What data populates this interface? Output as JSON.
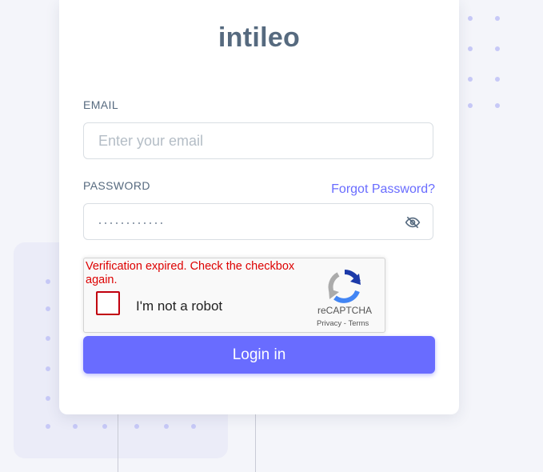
{
  "brand": {
    "logo_text": "intileo"
  },
  "form": {
    "email": {
      "label": "EMAIL",
      "placeholder": "Enter your email",
      "value": ""
    },
    "password": {
      "label": "PASSWORD",
      "masked_value": "············",
      "forgot_link": "Forgot Password?",
      "toggle_icon": "eye-off-icon"
    },
    "submit_label": "Login in"
  },
  "recaptcha": {
    "error_message": "Verification expired. Check the checkbox again.",
    "checkbox_label": "I'm not a robot",
    "checked": false,
    "brand": "reCAPTCHA",
    "privacy_link": "Privacy",
    "separator": " - ",
    "terms_link": "Terms"
  },
  "colors": {
    "accent": "#696cff",
    "error": "#dd0000",
    "text_muted": "#566a7f",
    "background": "#f4f5fa"
  }
}
